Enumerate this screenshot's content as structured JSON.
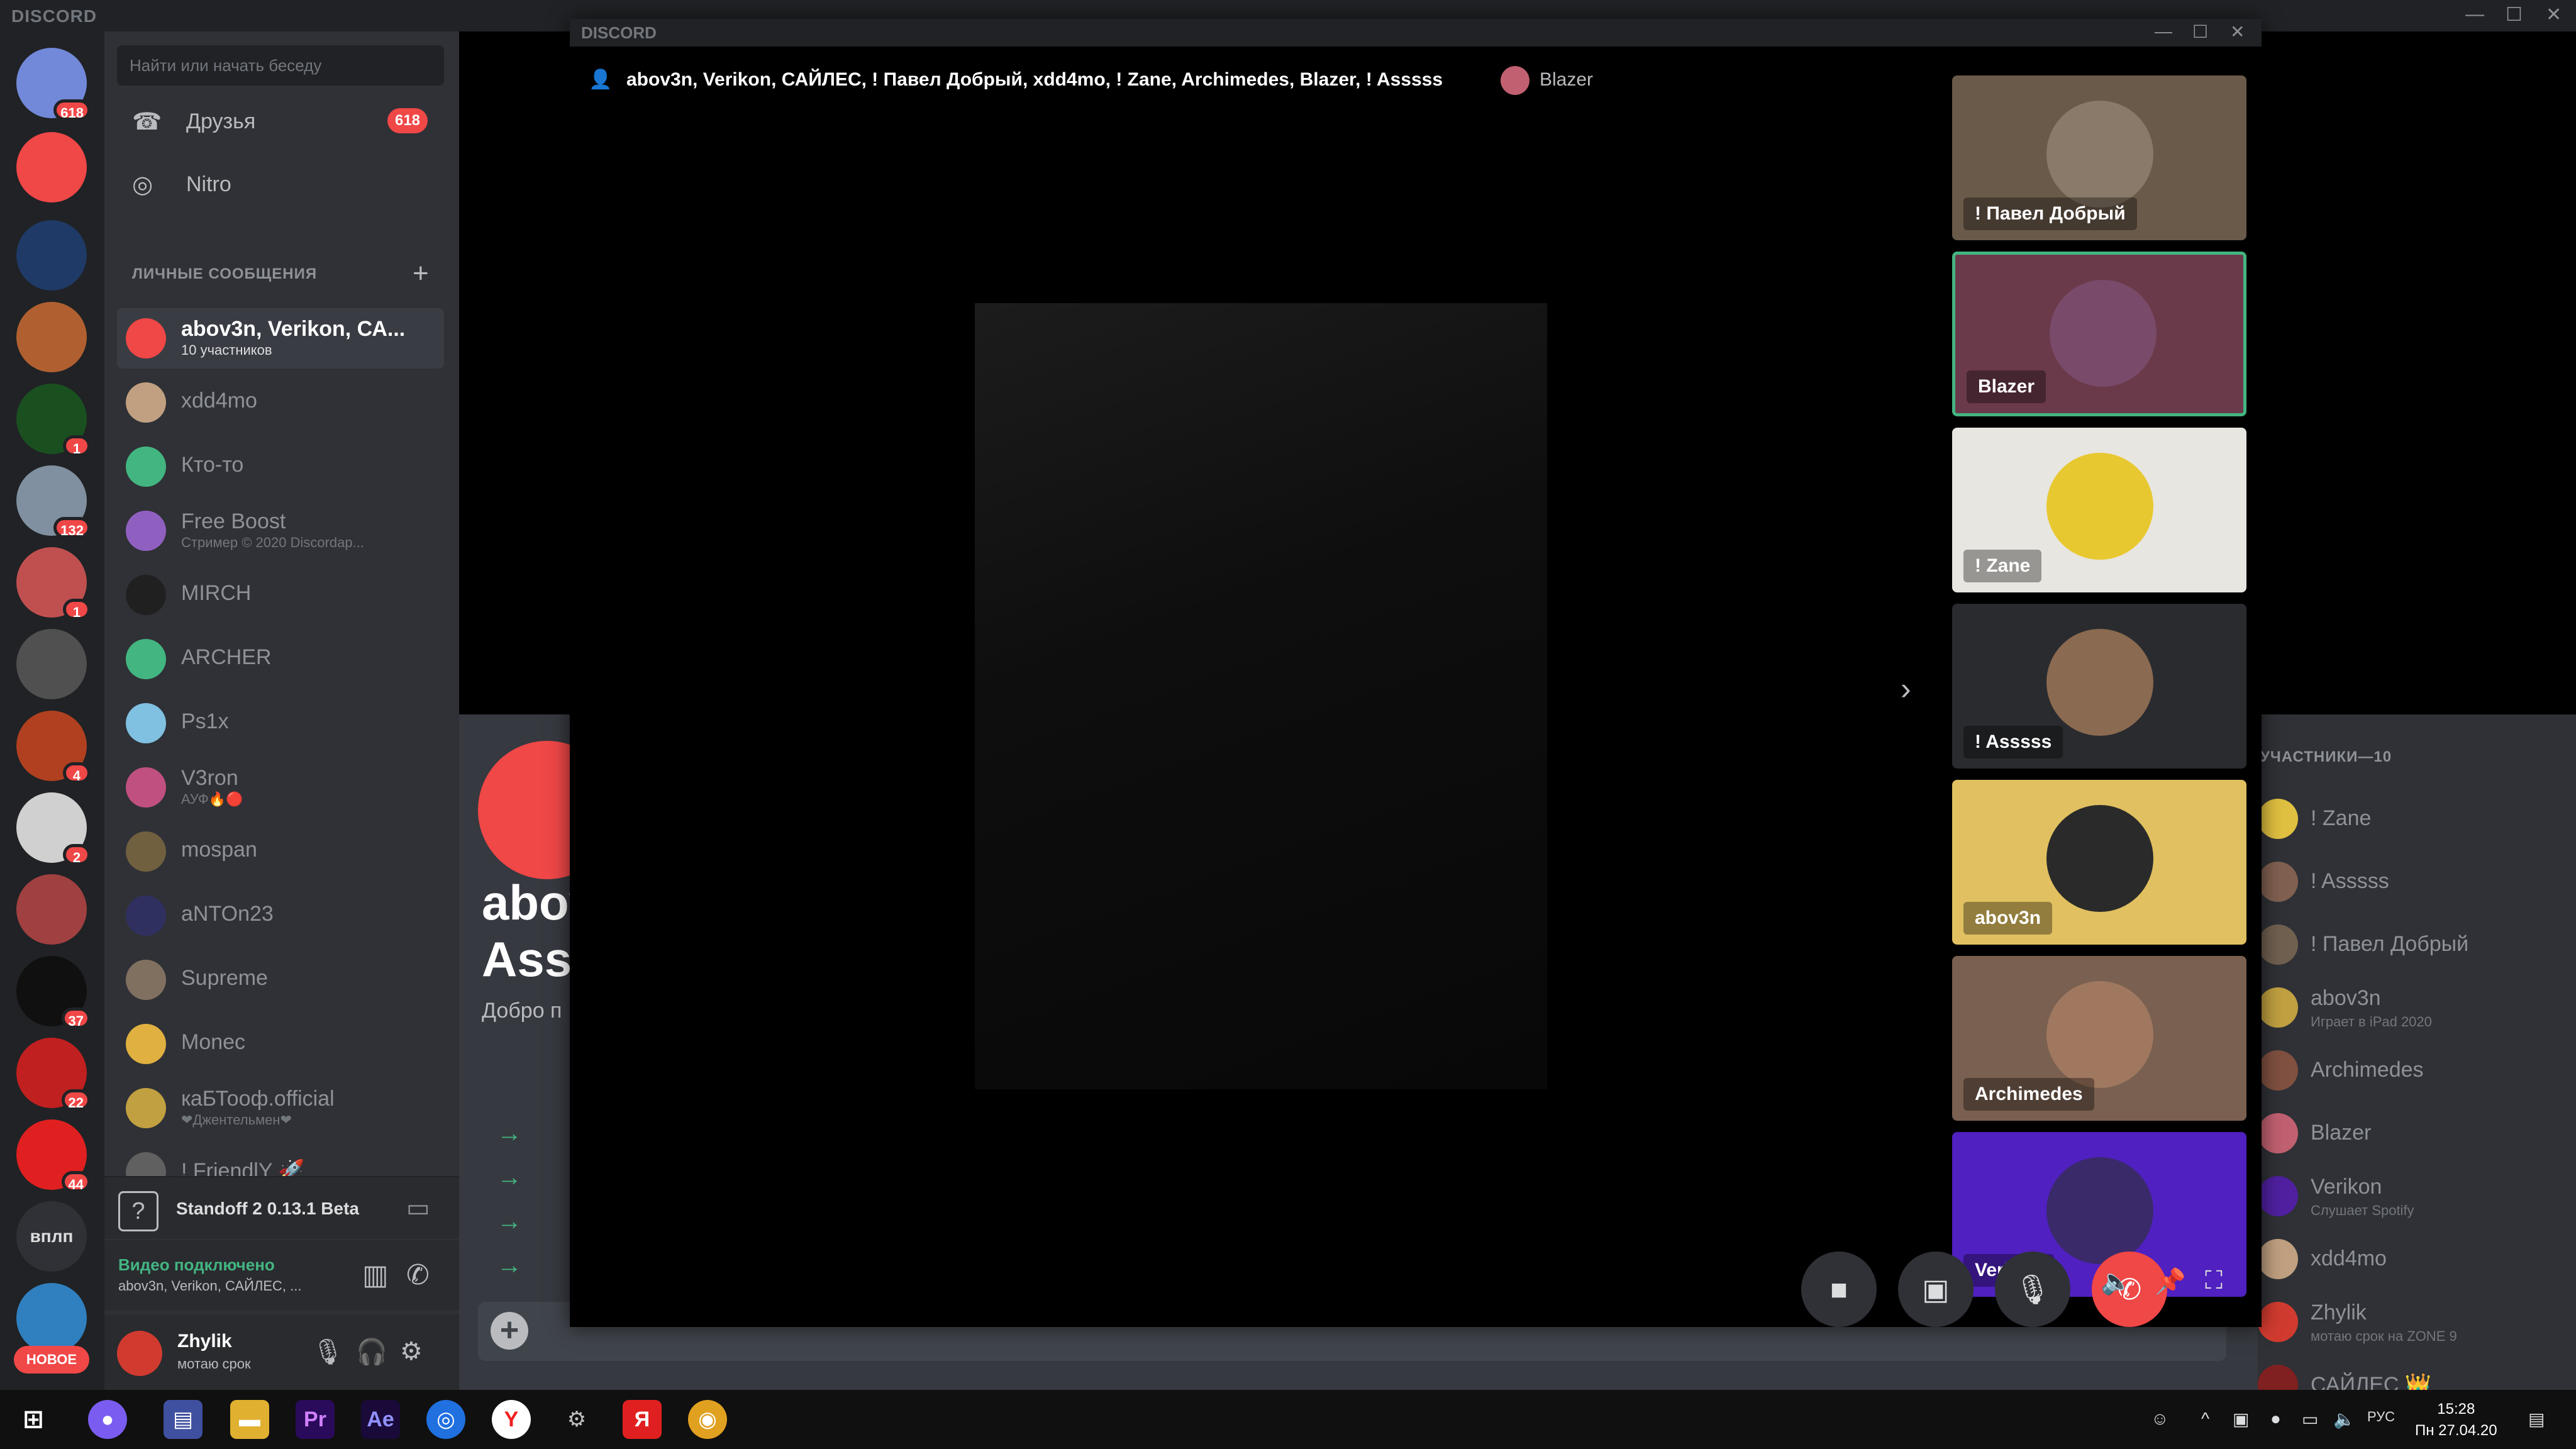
{
  "app": {
    "brand": "DISCORD",
    "overlay_brand": "DISCORD"
  },
  "servers": [
    {
      "badge": "618",
      "color": "#7289da",
      "icon": "discord-home-icon"
    },
    {
      "badge": "",
      "color": "#f04747",
      "icon": "friends-icon"
    },
    {
      "badge": "",
      "color": "#1f3a66",
      "icon": "server-icon"
    },
    {
      "badge": "",
      "color": "#b06030",
      "icon": "server-icon"
    },
    {
      "badge": "1",
      "color": "#1a5020",
      "icon": "server-icon"
    },
    {
      "badge": "132",
      "color": "#8090a0",
      "icon": "server-icon"
    },
    {
      "badge": "1",
      "color": "#c05050",
      "icon": "server-icon"
    },
    {
      "badge": "",
      "color": "#505050",
      "icon": "server-icon"
    },
    {
      "badge": "4",
      "color": "#b04020",
      "icon": "server-icon"
    },
    {
      "badge": "2",
      "color": "#d0d0d0",
      "icon": "server-icon"
    },
    {
      "badge": "",
      "color": "#a04040",
      "icon": "server-icon"
    },
    {
      "badge": "37",
      "color": "#101010",
      "icon": "server-icon"
    },
    {
      "badge": "22",
      "color": "#c02020",
      "icon": "server-icon"
    },
    {
      "badge": "44",
      "color": "#e02020",
      "icon": "server-icon"
    },
    {
      "badge": "",
      "color": "#2f3136",
      "icon": "server-icon",
      "label": "вплп"
    },
    {
      "badge": "",
      "color": "#3080c0",
      "icon": "server-icon"
    }
  ],
  "new_label": "НОВОЕ",
  "search": {
    "placeholder": "Найти или начать беседу"
  },
  "nav": {
    "friends": "Друзья",
    "friends_badge": "618",
    "nitro": "Nitro"
  },
  "dm_header": "ЛИЧНЫЕ СООБЩЕНИЯ",
  "dms": [
    {
      "name": "abov3n, Verikon, СА...",
      "sub": "10 участников",
      "color": "#f04747",
      "active": true
    },
    {
      "name": "xdd4mo",
      "sub": "",
      "color": "#c0a080"
    },
    {
      "name": "Кто-то",
      "sub": "",
      "color": "#43b581"
    },
    {
      "name": "Free Boost",
      "sub": "Стример © 2020 Discordap...",
      "color": "#9060c0"
    },
    {
      "name": "MIRCH",
      "sub": "",
      "color": "#202020"
    },
    {
      "name": "ARCHER",
      "sub": "",
      "color": "#43b581"
    },
    {
      "name": "Ps1x",
      "sub": "",
      "color": "#80c0e0"
    },
    {
      "name": "V3ron",
      "sub": "АУФ🔥🔴",
      "color": "#c05080"
    },
    {
      "name": "mospan",
      "sub": "",
      "color": "#706040"
    },
    {
      "name": "aNTOn23",
      "sub": "",
      "color": "#303060"
    },
    {
      "name": "Supreme",
      "sub": "",
      "color": "#807060"
    },
    {
      "name": "Monec",
      "sub": "",
      "color": "#e0b040"
    },
    {
      "name": "кaБТооф.official",
      "sub": "❤Джентельмен❤",
      "color": "#c0a040"
    },
    {
      "name": "! FriendlY 🚀",
      "sub": "",
      "color": "#606060"
    }
  ],
  "game": {
    "title": "Standoff 2 0.13.1 Beta"
  },
  "voice": {
    "status": "Видео подключено",
    "channel": "abov3n, Verikon, САЙЛЕС, ..."
  },
  "user": {
    "name": "Zhylik",
    "status": "мотаю срок"
  },
  "welcome": {
    "line1": "abov",
    "line2": "Asss",
    "line3": "Добро п"
  },
  "members": {
    "header": "УЧАСТНИКИ—10",
    "list": [
      {
        "name": "! Zane",
        "sub": "",
        "color": "#e0c040"
      },
      {
        "name": "! Asssss",
        "sub": "",
        "color": "#806050"
      },
      {
        "name": "! Павел Добрый",
        "sub": "",
        "color": "#706050"
      },
      {
        "name": "abov3n",
        "sub": "Играет в iPad 2020",
        "color": "#c0a040"
      },
      {
        "name": "Archimedes",
        "sub": "",
        "color": "#805040"
      },
      {
        "name": "Blazer",
        "sub": "",
        "color": "#c06070"
      },
      {
        "name": "Verikon",
        "sub": "Слушает Spotify",
        "color": "#5020a0"
      },
      {
        "name": "xdd4mo",
        "sub": "",
        "color": "#c0a080"
      },
      {
        "name": "Zhylik",
        "sub": "мотаю срок на ZONE 9",
        "color": "#d13b2f"
      },
      {
        "name": "САЙЛЕС 👑",
        "sub": "",
        "color": "#802020"
      }
    ]
  },
  "call": {
    "title": "abov3n, Verikon, САЙЛЕС, ! Павел Добрый, xdd4mo, ! Zane, Archimedes, Blazer, ! Asssss",
    "speaking": "Blazer",
    "tiles": [
      {
        "name": "! Павел Добрый",
        "bg": "#6a5a4a",
        "face": "#8a7a6a"
      },
      {
        "name": "Blazer",
        "bg": "#6a3a4a",
        "face": "#7a4a6a",
        "selected": true
      },
      {
        "name": "! Zane",
        "bg": "#e8e6e0",
        "face": "#e8c830"
      },
      {
        "name": "! Asssss",
        "bg": "#2a2b2f",
        "face": "#8a6a50"
      },
      {
        "name": "abov3n",
        "bg": "#e0c060",
        "face": "#2a2a2a"
      },
      {
        "name": "Archimedes",
        "bg": "#7a6050",
        "face": "#a07860"
      },
      {
        "name": "Verikon",
        "bg": "#5020c0",
        "face": "#3a2a6a"
      }
    ]
  },
  "clock": {
    "time": "15:28",
    "date": "Пн 27.04.20",
    "lang": "РУС"
  }
}
